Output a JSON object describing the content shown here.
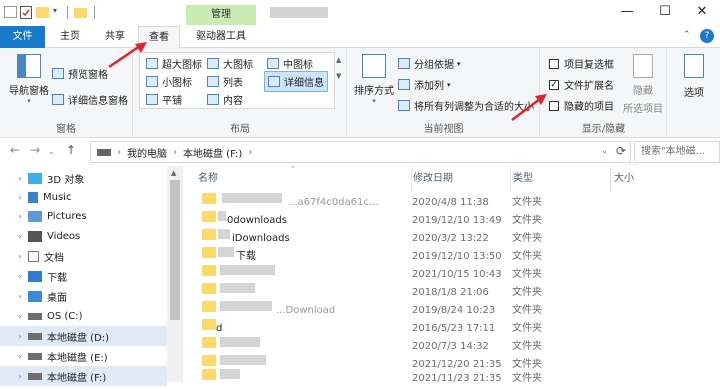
{
  "titlebar": {
    "manage_label": "管理",
    "minimize": "—",
    "maximize": "☐",
    "close": "✕",
    "help": "?"
  },
  "tabs": {
    "file": "文件",
    "home": "主页",
    "share": "共享",
    "view": "查看",
    "drive_tools": "驱动器工具"
  },
  "ribbon": {
    "panes": {
      "nav_pane": "导航窗格",
      "preview_pane": "预览窗格",
      "details_pane": "详细信息窗格",
      "label": "窗格"
    },
    "layout": {
      "extra_large": "超大图标",
      "large": "大图标",
      "medium": "中图标",
      "small": "小图标",
      "list": "列表",
      "details": "详细信息",
      "tiles": "平铺",
      "content": "内容",
      "label": "布局"
    },
    "current_view": {
      "sort_by": "排序方式",
      "group_by": "分组依据",
      "add_columns": "添加列",
      "size_all_columns": "将所有列调整为合适的大小",
      "label": "当前视图"
    },
    "show_hide": {
      "item_checkboxes": "项目复选框",
      "file_extensions": "文件扩展名",
      "hidden_items": "隐藏的项目",
      "hide": "隐藏",
      "hide_selected": "所选项目",
      "label": "显示/隐藏"
    },
    "options": "选项"
  },
  "address": {
    "path": [
      "我的电脑",
      "本地磁盘 (F:)"
    ],
    "search_placeholder": "搜索\"本地磁..."
  },
  "navpane": {
    "items": [
      {
        "label": "3D 对象",
        "expanded": false,
        "selected": false
      },
      {
        "label": "Music",
        "expanded": false,
        "selected": false
      },
      {
        "label": "Pictures",
        "expanded": false,
        "selected": false
      },
      {
        "label": "Videos",
        "expanded": false,
        "selected": false
      },
      {
        "label": "文档",
        "expanded": false,
        "selected": false
      },
      {
        "label": "下载",
        "expanded": false,
        "selected": false
      },
      {
        "label": "桌面",
        "expanded": false,
        "selected": false
      },
      {
        "label": "OS (C:)",
        "expanded": false,
        "selected": false
      },
      {
        "label": "本地磁盘 (D:)",
        "expanded": false,
        "selected": true
      },
      {
        "label": "本地磁盘 (E:)",
        "expanded": false,
        "selected": false
      },
      {
        "label": "本地磁盘 (F:)",
        "expanded": false,
        "selected": true
      }
    ]
  },
  "columns": {
    "name": "名称",
    "modified": "修改日期",
    "type": "类型",
    "size": "大小"
  },
  "files": [
    {
      "name": "...a67f4c0da61c...",
      "modified": "2020/4/8 11:38",
      "type": "文件夹"
    },
    {
      "name": "0downloads",
      "modified": "2019/12/10 13:49",
      "type": "文件夹"
    },
    {
      "name": "iDownloads",
      "modified": "2020/3/2 13:22",
      "type": "文件夹"
    },
    {
      "name": "下载",
      "modified": "2019/12/10 13:50",
      "type": "文件夹"
    },
    {
      "name": "",
      "modified": "2021/10/15 10:43",
      "type": "文件夹"
    },
    {
      "name": "",
      "modified": "2018/1/8 21:06",
      "type": "文件夹"
    },
    {
      "name": "...Download",
      "modified": "2019/8/24 10:23",
      "type": "文件夹"
    },
    {
      "name": "d",
      "modified": "2016/5/23 17:11",
      "type": "文件夹"
    },
    {
      "name": "",
      "modified": "2020/7/3 14:32",
      "type": "文件夹"
    },
    {
      "name": "",
      "modified": "2021/12/20 21:35",
      "type": "文件夹"
    },
    {
      "name": "",
      "modified": "2021/11/23 21:35",
      "type": "文件夹"
    }
  ],
  "colors": {
    "accent": "#1979ca",
    "manage_bg": "#c9ecb3",
    "annotation_arrow": "#e0242c",
    "folder": "#ffd86b"
  }
}
